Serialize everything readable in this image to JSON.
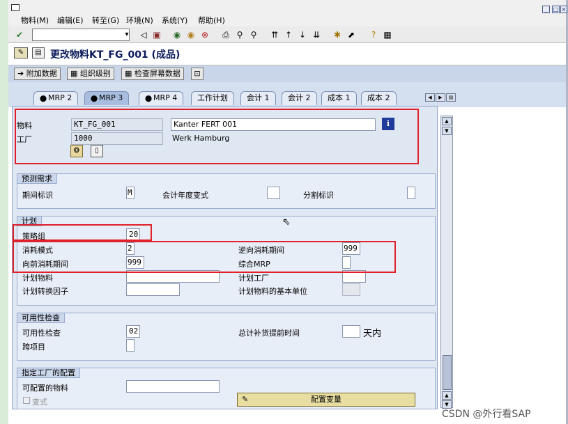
{
  "menu": {
    "items": [
      "物料(M)",
      "编辑(E)",
      "转至(G)",
      "环境(N)",
      "系统(Y)",
      "帮助(H)"
    ]
  },
  "toolbar": {
    "command_value": ""
  },
  "title": "更改物料KT_FG_001 (成品)",
  "app_toolbar": {
    "additional_data": "附加数据",
    "org_levels": "组织级别",
    "check_screen": "检查屏幕数据"
  },
  "tabs": [
    {
      "label": "MRP 2",
      "active": false
    },
    {
      "label": "MRP 3",
      "active": true
    },
    {
      "label": "MRP 4",
      "active": false
    },
    {
      "label": "工作计划",
      "active": false
    },
    {
      "label": "会计 1",
      "active": false
    },
    {
      "label": "会计 2",
      "active": false
    },
    {
      "label": "成本 1",
      "active": false
    },
    {
      "label": "成本 2",
      "active": false
    }
  ],
  "header": {
    "material_label": "物料",
    "material_value": "KT_FG_001",
    "material_desc": "Kanter FERT 001",
    "plant_label": "工厂",
    "plant_value": "1000",
    "plant_desc": "Werk Hamburg"
  },
  "forecast": {
    "title": "预测需求",
    "period_label": "期间标识",
    "period_value": "M",
    "fiscal_variant_label": "会计年度变式",
    "fiscal_variant_value": "",
    "splitting_label": "分割标识",
    "splitting_value": ""
  },
  "planning": {
    "title": "计划",
    "strategy_group_label": "策略组",
    "strategy_group_value": "20",
    "consumption_mode_label": "消耗模式",
    "consumption_mode_value": "2",
    "bwd_period_label": "逆向消耗期间",
    "bwd_period_value": "999",
    "fwd_period_label": "向前消耗期间",
    "fwd_period_value": "999",
    "mixed_mrp_label": "综合MRP",
    "mixed_mrp_value": "",
    "planning_material_label": "计划物料",
    "planning_material_value": "",
    "planning_plant_label": "计划工厂",
    "planning_plant_value": "",
    "conv_factor_label": "计划转换因子",
    "conv_factor_value": "",
    "base_unit_label": "计划物料的基本单位",
    "base_unit_value": ""
  },
  "availability": {
    "title": "可用性检查",
    "check_label": "可用性检查",
    "check_value": "02",
    "total_rlt_label": "总计补货提前时间",
    "total_rlt_value": "",
    "total_rlt_unit": "天内",
    "cross_project_label": "跨项目",
    "cross_project_value": ""
  },
  "plant_config": {
    "title": "指定工厂的配置",
    "configurable_label": "可配置的物料",
    "configurable_value": "",
    "variant_label": "变式",
    "configure_variant_button": "配置变量"
  },
  "watermark": "CSDN @外行看SAP"
}
